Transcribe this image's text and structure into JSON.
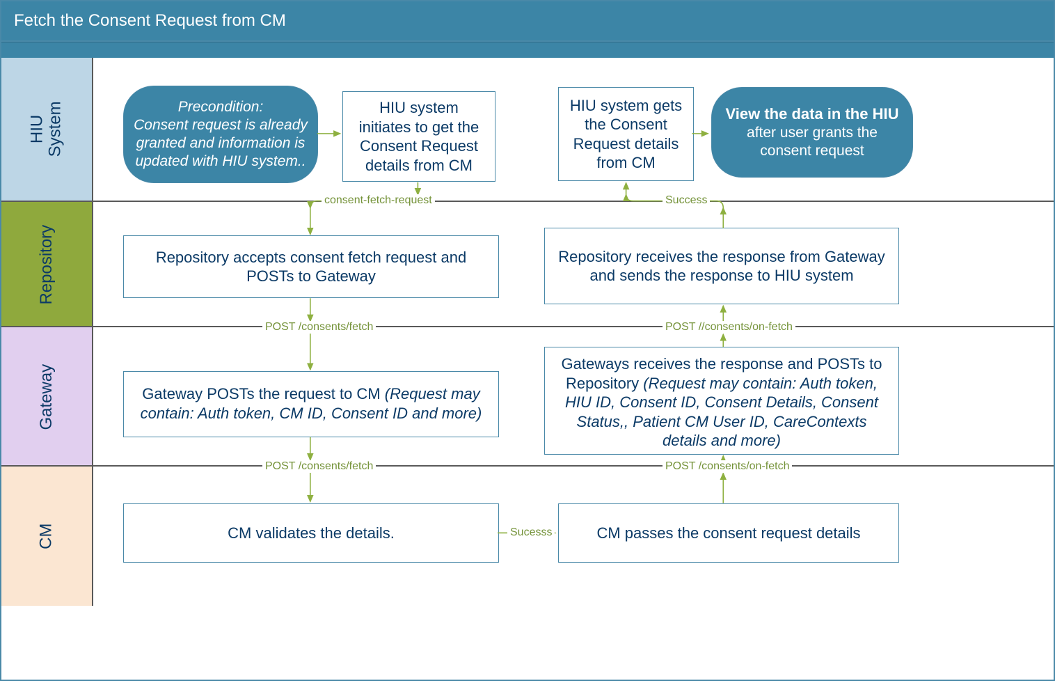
{
  "title": "Fetch the Consent Request from CM",
  "lanes": {
    "hiu": "HIU\nSystem",
    "repo": "Repository",
    "gw": "Gateway",
    "cm": "CM"
  },
  "nodes": {
    "precondition": "Precondition:\nConsent request is already granted and information is updated with HIU system..",
    "hiu_init": "HIU system initiates to get the Consent Request details from CM",
    "hiu_gets": "HIU system gets the Consent Request details from CM",
    "end_bold": "View the data in the HIU",
    "end_rest": "after user grants the consent request",
    "repo_accept": "Repository accepts consent fetch request and POSTs to Gateway",
    "repo_receive": "Repository receives the response from Gateway and sends the response to HIU system",
    "gw_post_main": "Gateway POSTs the request to CM  ",
    "gw_post_note": "(Request may contain: Auth token, CM ID, Consent ID and more)",
    "gw_recv_main": "Gateways receives the response and POSTs to Repository ",
    "gw_recv_note": "(Request may contain: Auth token, HIU ID,  Consent ID, Consent Details, Consent Status,, Patient CM User ID, CareContexts details and more)",
    "cm_validate": "CM validates the details.",
    "cm_pass": "CM passes the consent request details"
  },
  "edges": {
    "consent_fetch_request": "consent-fetch-request",
    "post_fetch": "POST /consents/fetch",
    "post_fetch2": "POST /consents/fetch",
    "sucesss": "Sucesss",
    "post_on_fetch": "POST /consents/on-fetch",
    "post_on_fetch2": "POST //consents/on-fetch",
    "success": "Success"
  }
}
